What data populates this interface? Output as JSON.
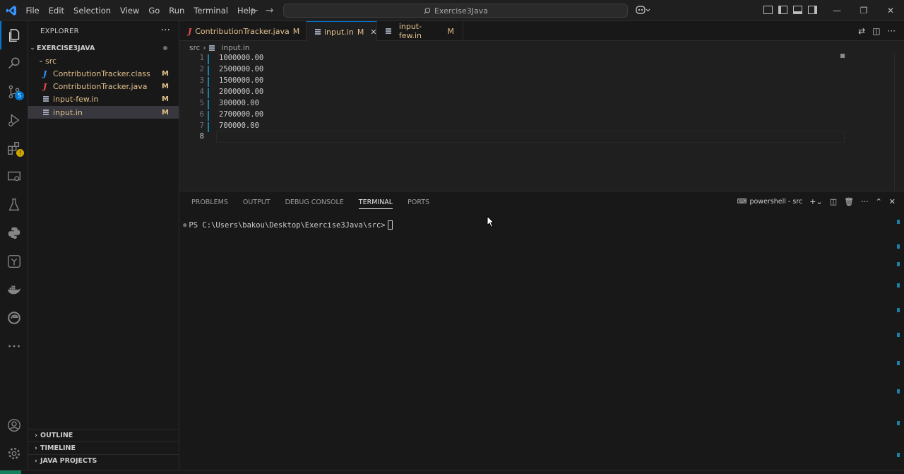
{
  "window": {
    "menu": [
      "File",
      "Edit",
      "Selection",
      "View",
      "Go",
      "Run",
      "Terminal",
      "Help"
    ],
    "search_text": "Exercise3Java"
  },
  "activity_bar": {
    "icons": [
      "explorer-icon",
      "search-icon",
      "source-control-icon",
      "run-debug-icon",
      "extensions-icon",
      "remote-explorer-icon",
      "testing-icon",
      "python-icon",
      "sourcetree-icon",
      "docker-icon",
      "edge-icon",
      "more-icon",
      "account-icon",
      "settings-icon"
    ],
    "source_control_badge": "5"
  },
  "sidebar": {
    "title": "EXPLORER",
    "root": "EXERCISE3JAVA",
    "folder": "src",
    "files": [
      {
        "name": "ContributionTracker.class",
        "status": "M",
        "icon": "class-file-icon"
      },
      {
        "name": "ContributionTracker.java",
        "status": "M",
        "icon": "java-file-icon"
      },
      {
        "name": "input-few.in",
        "status": "M",
        "icon": "text-file-icon"
      },
      {
        "name": "input.in",
        "status": "M",
        "icon": "text-file-icon"
      }
    ],
    "sections": [
      "OUTLINE",
      "TIMELINE",
      "JAVA PROJECTS"
    ]
  },
  "tabs": [
    {
      "label": "ContributionTracker.java",
      "status": "M"
    },
    {
      "label": "input.in",
      "status": "M"
    },
    {
      "label": "input-few.in",
      "status": "M"
    }
  ],
  "breadcrumb": {
    "folder": "src",
    "file": "input.in"
  },
  "editor": {
    "lines": [
      "1000000.00",
      "2500000.00",
      "1500000.00",
      "2000000.00",
      "300000.00",
      "2700000.00",
      "700000.00",
      ""
    ],
    "line_numbers": [
      "1",
      "2",
      "3",
      "4",
      "5",
      "6",
      "7",
      "8"
    ]
  },
  "panel": {
    "tabs": [
      "PROBLEMS",
      "OUTPUT",
      "DEBUG CONSOLE",
      "TERMINAL",
      "PORTS"
    ],
    "active_tab": "TERMINAL",
    "terminal_name": "powershell - src",
    "prompt": "PS C:\\Users\\bakou\\Desktop\\Exercise3Java\\src>"
  }
}
